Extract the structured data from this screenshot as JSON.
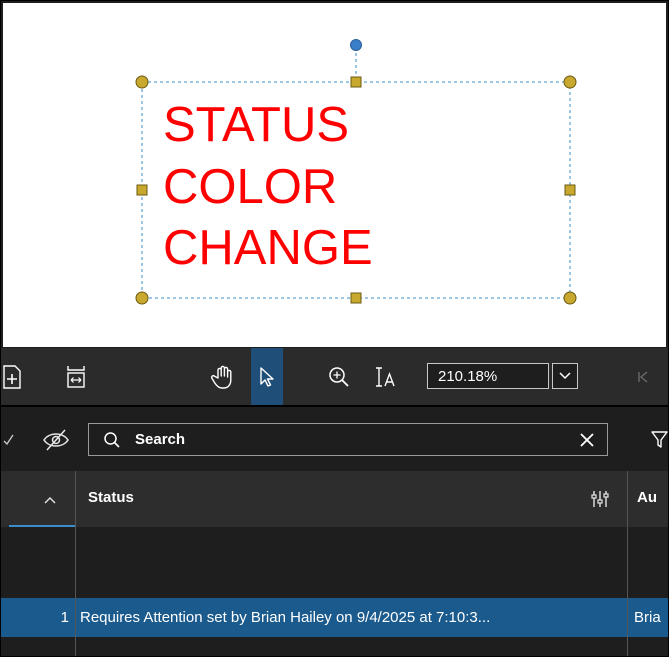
{
  "canvas": {
    "markup_lines": [
      "STATUS",
      "COLOR",
      "CHANGE"
    ],
    "markup_color": "#ff0000",
    "selection_color": "#3a8ec9",
    "handle_color": "#c9a830",
    "rotate_handle_color": "#3a7fc8"
  },
  "toolbar": {
    "zoom_value": "210.18%",
    "tools": [
      "insert-page-icon",
      "page-fit-icon",
      "pan-hand-icon",
      "select-arrow-icon",
      "zoom-in-icon",
      "text-select-icon",
      "first-page-icon"
    ],
    "active_tool": "select-arrow-icon",
    "active_color": "#1f4f78"
  },
  "search": {
    "placeholder": "Search",
    "icons": [
      "checkmark-icon",
      "eye-slash-icon",
      "search-icon",
      "clear-icon",
      "filter-icon"
    ]
  },
  "grid": {
    "columns": [
      "Status",
      "Au"
    ],
    "sort_icon": "chevron-up-icon",
    "column_options_icon": "column-options-icon",
    "rows": [
      {
        "number": "1",
        "status": "Requires Attention set by Brian Hailey on 9/4/2025 at 7:10:3...",
        "author": "Bria",
        "selected": true
      }
    ],
    "selected_row_color": "#1b5a8c"
  }
}
